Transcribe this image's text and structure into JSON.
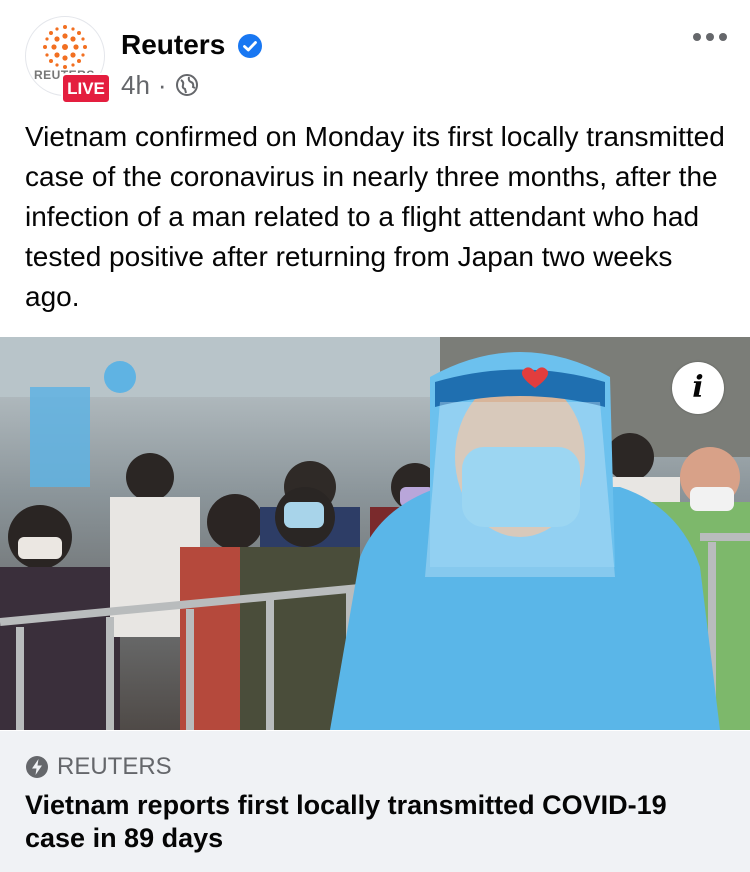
{
  "post": {
    "page_name": "Reuters",
    "avatar_text": "REUTERS",
    "live_label": "LIVE",
    "time": "4h",
    "separator": "·",
    "text": "Vietnam confirmed on Monday its first locally transmitted case of the coronavirus in nearly three months, after the infection of a man related to a flight attendant who had tested positive after returning from Japan two weeks ago.",
    "icons": {
      "verified": "verified-check-icon",
      "privacy": "globe-icon",
      "more": "more-dots-icon",
      "info": "info-icon",
      "source": "bolt-icon"
    },
    "info_label": "i"
  },
  "link_preview": {
    "source": "REUTERS",
    "title": "Vietnam reports first locally transmitted COVID-19 case in 89 days"
  },
  "colors": {
    "brand_orange": "#f26f21",
    "verified_blue": "#1877f2",
    "live_red": "#e41e3f",
    "meta_gray": "#65676b",
    "preview_bg": "#f0f2f5"
  }
}
